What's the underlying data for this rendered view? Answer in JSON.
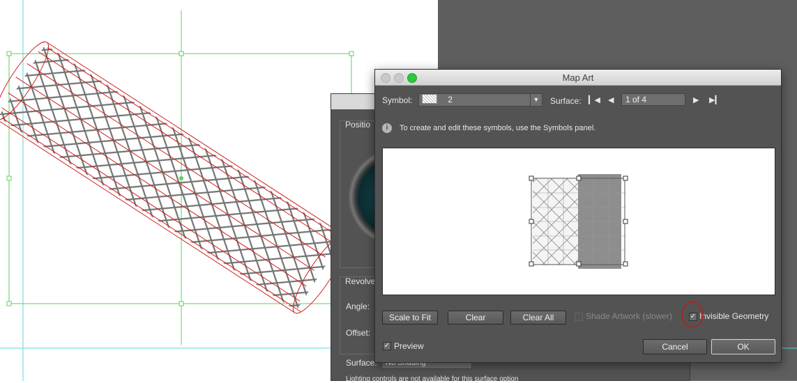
{
  "colors": {
    "canvas_bg": "#ffffff",
    "pasteboard": "#5e5e5e",
    "dialog_bg": "#535353",
    "guide": "#5fd6d6",
    "bounding_box": "#5ad15a",
    "mesh_red": "#d01f1f",
    "mesh_gray": "#6b6b6b",
    "annotation_circle": "#c01818"
  },
  "background_dialog": {
    "labels": {
      "position": "Positio",
      "revolve": "Revolve",
      "angle": "Angle:",
      "offset": "Offset:",
      "surface": "Surface:",
      "surface_value": "No Shading",
      "lighting_note": "Lighting controls are not available for this surface option"
    }
  },
  "dialog": {
    "title": "Map Art",
    "symbol": {
      "label": "Symbol:",
      "value": "2"
    },
    "surface": {
      "label": "Surface:",
      "value": "1 of 4"
    },
    "info_text": "To create and edit these symbols, use the Symbols panel.",
    "buttons": {
      "scale_to_fit": "Scale to Fit",
      "clear": "Clear",
      "clear_all": "Clear All",
      "cancel": "Cancel",
      "ok": "OK"
    },
    "checkboxes": {
      "shade_artwork": {
        "label": "Shade Artwork (slower)",
        "checked": false,
        "enabled": false
      },
      "invisible_geometry": {
        "label": "Invisible Geometry",
        "checked": true
      },
      "preview": {
        "label": "Preview",
        "checked": true
      }
    },
    "icons": {
      "info": "info-icon",
      "first": "first-page-icon",
      "prev": "previous-page-icon",
      "next": "next-page-icon",
      "last": "last-page-icon",
      "dropdown": "chevron-down-icon"
    }
  }
}
